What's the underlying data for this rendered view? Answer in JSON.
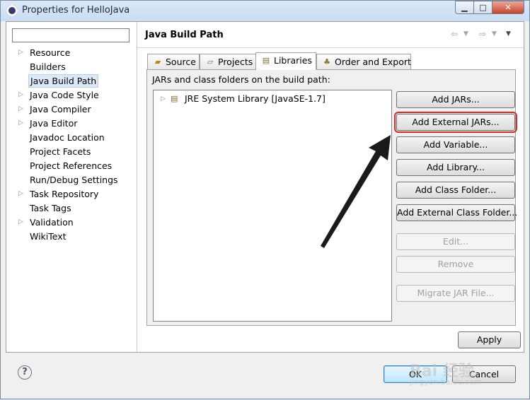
{
  "window": {
    "title": "Properties for HelloJava"
  },
  "sidebar": {
    "filter_value": "",
    "items": [
      {
        "label": "Resource",
        "expandable": true
      },
      {
        "label": "Builders",
        "expandable": false
      },
      {
        "label": "Java Build Path",
        "expandable": false,
        "selected": true
      },
      {
        "label": "Java Code Style",
        "expandable": true
      },
      {
        "label": "Java Compiler",
        "expandable": true
      },
      {
        "label": "Java Editor",
        "expandable": true
      },
      {
        "label": "Javadoc Location",
        "expandable": false
      },
      {
        "label": "Project Facets",
        "expandable": false
      },
      {
        "label": "Project References",
        "expandable": false
      },
      {
        "label": "Run/Debug Settings",
        "expandable": false
      },
      {
        "label": "Task Repository",
        "expandable": true
      },
      {
        "label": "Task Tags",
        "expandable": false
      },
      {
        "label": "Validation",
        "expandable": true
      },
      {
        "label": "WikiText",
        "expandable": false
      }
    ]
  },
  "page": {
    "title": "Java Build Path",
    "tabs": [
      {
        "label": "Source",
        "icon": "source-folder-icon"
      },
      {
        "label": "Projects",
        "icon": "projects-icon"
      },
      {
        "label": "Libraries",
        "icon": "libraries-icon",
        "active": true
      },
      {
        "label": "Order and Export",
        "icon": "order-export-icon"
      }
    ],
    "panel_label": "JARs and class folders on the build path:",
    "libraries": [
      {
        "label": "JRE System Library [JavaSE-1.7]"
      }
    ],
    "buttons": {
      "add_jars": "Add JARs...",
      "add_external_jars": "Add External JARs...",
      "add_variable": "Add Variable...",
      "add_library": "Add Library...",
      "add_class_folder": "Add Class Folder...",
      "add_external_class_folder": "Add External Class Folder...",
      "edit": "Edit...",
      "remove": "Remove",
      "migrate_jar": "Migrate JAR File..."
    },
    "apply_label": "Apply"
  },
  "dialog": {
    "ok_label": "OK",
    "cancel_label": "Cancel",
    "help_symbol": "?"
  },
  "watermark": {
    "line1": "Bai 经验",
    "line2": "jingyan.baidu.com"
  },
  "colors": {
    "highlight": "#d42a2a",
    "selection": "#dbe8f6",
    "arrow": "#1a1a1a"
  }
}
